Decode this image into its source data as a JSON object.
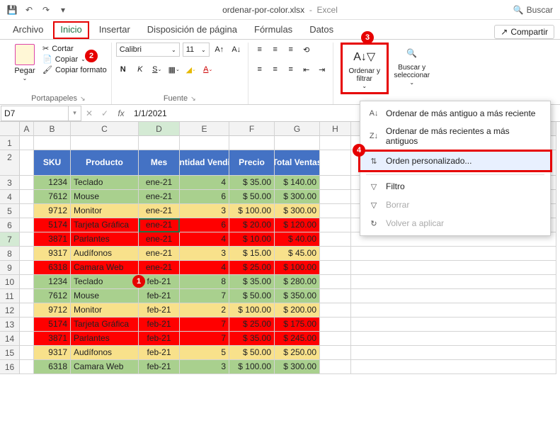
{
  "titlebar": {
    "filename": "ordenar-por-color.xlsx",
    "app": "Excel",
    "search": "Buscar"
  },
  "tabs": {
    "archivo": "Archivo",
    "inicio": "Inicio",
    "insertar": "Insertar",
    "disposicion": "Disposición de página",
    "formulas": "Fórmulas",
    "datos": "Datos",
    "compartir": "Compartir"
  },
  "ribbon": {
    "pegar": "Pegar",
    "cortar": "Cortar",
    "copiar": "Copiar",
    "copiar_formato": "Copiar formato",
    "portapapeles": "Portapapeles",
    "font_name": "Calibri",
    "font_size": "11",
    "fuente": "Fuente",
    "ordenar_filtrar": "Ordenar y filtrar",
    "buscar_seleccionar": "Buscar y seleccionar"
  },
  "menu": {
    "asc": "Ordenar de más antiguo a más reciente",
    "desc": "Ordenar de más recientes a más antiguos",
    "custom": "Orden personalizado...",
    "filtro": "Filtro",
    "borrar": "Borrar",
    "reapply": "Volver a aplicar"
  },
  "formula": {
    "name_box": "D7",
    "value": "1/1/2021"
  },
  "columns": [
    "A",
    "B",
    "C",
    "D",
    "E",
    "F",
    "G",
    "H"
  ],
  "headers": {
    "sku": "SKU",
    "producto": "Producto",
    "mes": "Mes",
    "cantidad": "Cantidad Vendida",
    "precio": "Precio",
    "total": "Total Ventas"
  },
  "rows": [
    {
      "r": 3,
      "color": "green",
      "sku": "1234",
      "prod": "Teclado",
      "mes": "ene-21",
      "qty": "4",
      "pre": "$   35.00",
      "tot": "$ 140.00"
    },
    {
      "r": 4,
      "color": "green",
      "sku": "7612",
      "prod": "Mouse",
      "mes": "ene-21",
      "qty": "6",
      "pre": "$   50.00",
      "tot": "$ 300.00"
    },
    {
      "r": 5,
      "color": "yellow",
      "sku": "9712",
      "prod": "Monitor",
      "mes": "ene-21",
      "qty": "3",
      "pre": "$ 100.00",
      "tot": "$ 300.00"
    },
    {
      "r": 6,
      "color": "red",
      "sku": "5174",
      "prod": "Tarjeta Gráfica",
      "mes": "ene-21",
      "qty": "6",
      "pre": "$   20.00",
      "tot": "$ 120.00"
    },
    {
      "r": 7,
      "color": "red",
      "sku": "3871",
      "prod": "Parlantes",
      "mes": "ene-21",
      "qty": "4",
      "pre": "$   10.00",
      "tot": "$   40.00"
    },
    {
      "r": 8,
      "color": "yellow",
      "sku": "9317",
      "prod": "Audífonos",
      "mes": "ene-21",
      "qty": "3",
      "pre": "$   15.00",
      "tot": "$   45.00"
    },
    {
      "r": 9,
      "color": "red",
      "sku": "6318",
      "prod": "Camara Web",
      "mes": "ene-21",
      "qty": "4",
      "pre": "$   25.00",
      "tot": "$ 100.00"
    },
    {
      "r": 10,
      "color": "green",
      "sku": "1234",
      "prod": "Teclado",
      "mes": "feb-21",
      "qty": "8",
      "pre": "$   35.00",
      "tot": "$ 280.00"
    },
    {
      "r": 11,
      "color": "green",
      "sku": "7612",
      "prod": "Mouse",
      "mes": "feb-21",
      "qty": "7",
      "pre": "$   50.00",
      "tot": "$ 350.00"
    },
    {
      "r": 12,
      "color": "yellow",
      "sku": "9712",
      "prod": "Monitor",
      "mes": "feb-21",
      "qty": "2",
      "pre": "$ 100.00",
      "tot": "$ 200.00"
    },
    {
      "r": 13,
      "color": "red",
      "sku": "5174",
      "prod": "Tarjeta Gráfica",
      "mes": "feb-21",
      "qty": "7",
      "pre": "$   25.00",
      "tot": "$ 175.00"
    },
    {
      "r": 14,
      "color": "red",
      "sku": "3871",
      "prod": "Parlantes",
      "mes": "feb-21",
      "qty": "7",
      "pre": "$   35.00",
      "tot": "$ 245.00"
    },
    {
      "r": 15,
      "color": "yellow",
      "sku": "9317",
      "prod": "Audífonos",
      "mes": "feb-21",
      "qty": "5",
      "pre": "$   50.00",
      "tot": "$ 250.00"
    },
    {
      "r": 16,
      "color": "green",
      "sku": "6318",
      "prod": "Camara Web",
      "mes": "feb-21",
      "qty": "3",
      "pre": "$ 100.00",
      "tot": "$ 300.00"
    }
  ],
  "callouts": {
    "c1": "1",
    "c2": "2",
    "c3": "3",
    "c4": "4"
  }
}
